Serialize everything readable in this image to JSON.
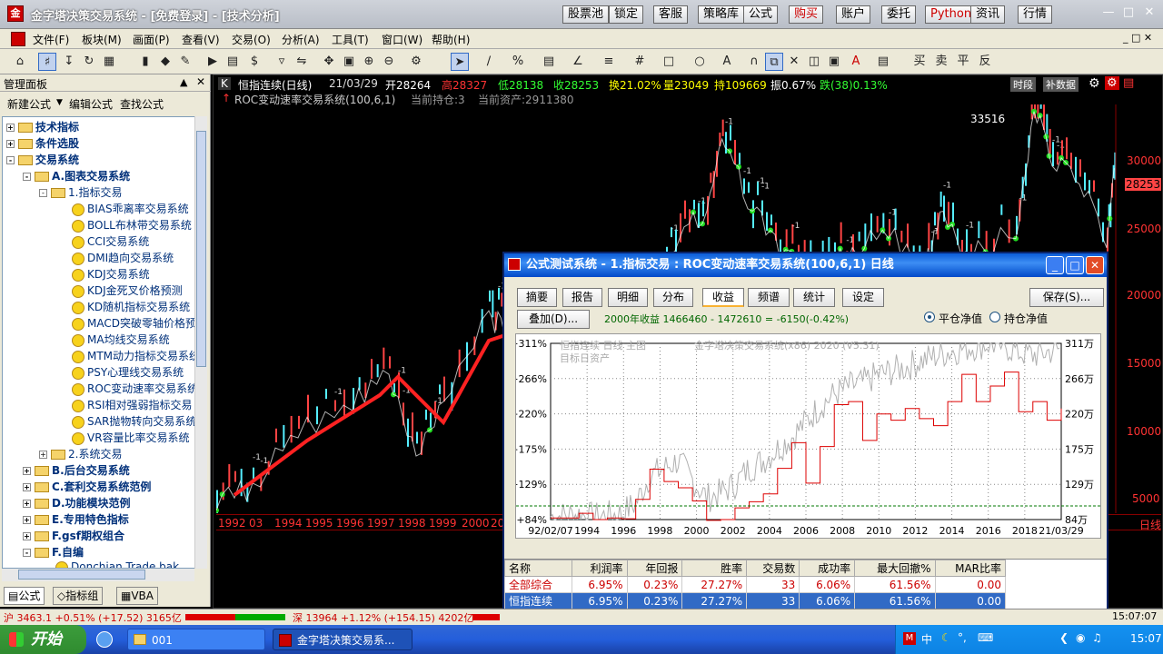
{
  "title_bar": {
    "title": "金字塔决策交易系统 - [免费登录] - [技术分析]",
    "buttons": [
      "股票池",
      "锁定",
      "客服",
      "策略库",
      "公式",
      "购买",
      "账户",
      "委托",
      "Python",
      "资讯",
      "行情"
    ]
  },
  "menu": [
    "文件(F)",
    "板块(M)",
    "画面(P)",
    "查看(V)",
    "交易(O)",
    "分析(A)",
    "工具(T)",
    "窗口(W)",
    "帮助(H)"
  ],
  "left_panel": {
    "title": "管理面板",
    "actions": [
      "新建公式",
      "编辑公式",
      "查找公式"
    ],
    "tree": [
      {
        "label": "技术指标",
        "level": 0,
        "type": "folder",
        "exp": "+"
      },
      {
        "label": "条件选股",
        "level": 0,
        "type": "folder",
        "exp": "+"
      },
      {
        "label": "交易系统",
        "level": 0,
        "type": "folder",
        "exp": "-"
      },
      {
        "label": "A.图表交易系统",
        "level": 1,
        "type": "folder",
        "exp": "-"
      },
      {
        "label": "1.指标交易",
        "level": 2,
        "type": "folder",
        "exp": "-"
      },
      {
        "label": "BIAS乖离率交易系统",
        "level": 3,
        "type": "item"
      },
      {
        "label": "BOLL布林带交易系统",
        "level": 3,
        "type": "item"
      },
      {
        "label": "CCI交易系统",
        "level": 3,
        "type": "item"
      },
      {
        "label": "DMI趋向交易系统",
        "level": 3,
        "type": "item"
      },
      {
        "label": "KDJ交易系统",
        "level": 3,
        "type": "item"
      },
      {
        "label": "KDJ金死叉价格预测",
        "level": 3,
        "type": "item"
      },
      {
        "label": "KD随机指标交易系统",
        "level": 3,
        "type": "item"
      },
      {
        "label": "MACD突破零轴价格预",
        "level": 3,
        "type": "item"
      },
      {
        "label": "MA均线交易系统",
        "level": 3,
        "type": "item"
      },
      {
        "label": "MTM动力指标交易系统",
        "level": 3,
        "type": "item"
      },
      {
        "label": "PSY心理线交易系统",
        "level": 3,
        "type": "item"
      },
      {
        "label": "ROC变动速率交易系统",
        "level": 3,
        "type": "item"
      },
      {
        "label": "RSI相对强弱指标交易",
        "level": 3,
        "type": "item"
      },
      {
        "label": "SAR抛物转向交易系统",
        "level": 3,
        "type": "item"
      },
      {
        "label": "VR容量比率交易系统",
        "level": 3,
        "type": "item"
      },
      {
        "label": "2.系统交易",
        "level": 2,
        "type": "folder",
        "exp": "+"
      },
      {
        "label": "B.后台交易系统",
        "level": 1,
        "type": "folder",
        "exp": "+"
      },
      {
        "label": "C.套利交易系统范例",
        "level": 1,
        "type": "folder",
        "exp": "+"
      },
      {
        "label": "D.功能模块范例",
        "level": 1,
        "type": "folder",
        "exp": "+"
      },
      {
        "label": "E.专用特色指标",
        "level": 1,
        "type": "folder",
        "exp": "+"
      },
      {
        "label": "F.gsf期权组合",
        "level": 1,
        "type": "folder",
        "exp": "+"
      },
      {
        "label": "F.自编",
        "level": 1,
        "type": "folder",
        "exp": "-"
      },
      {
        "label": "Donchian Trade.bak",
        "level": 2,
        "type": "item"
      }
    ],
    "bottom_tabs": [
      "公式",
      "指标组",
      "VBA"
    ]
  },
  "chart": {
    "header_line1": {
      "name": "恒指连续(日线)",
      "date": "21/03/29",
      "open": "开28264",
      "high": "高28327",
      "low": "低28138",
      "close": "收28253",
      "turnover": "换21.02%",
      "volume": "量23049",
      "hold": "持109669",
      "amplitude": "振0.67%",
      "change": "跌(38)0.13%"
    },
    "header_line2": {
      "system": "ROC变动速率交易系统(100,6,1)",
      "position": "当前持仓:3",
      "assets": "当前资产:2911380"
    },
    "right_buttons": [
      "时段",
      "补数据"
    ],
    "price_axis": [
      "30000",
      "25000",
      "20000",
      "15000",
      "10000",
      "5000"
    ],
    "last_price": "28253",
    "peak_label": "33516",
    "year_axis": [
      "1992",
      "03",
      "1994",
      "1995",
      "1996",
      "1997",
      "1998",
      "1999",
      "2000",
      "20"
    ],
    "period_label": "日线"
  },
  "dialog": {
    "title": "公式测试系统 - 1.指标交易 : ROC变动速率交易系统(100,6,1) 日线",
    "tabs": [
      "摘要",
      "报告",
      "明细",
      "分布",
      "收益",
      "频谱",
      "统计",
      "设定"
    ],
    "active_tab": "收益",
    "save_button": "保存(S)...",
    "overlay_button": "叠加(D)...",
    "year_return": "2000年收益 1466460 - 1472610 = -6150(-0.42%)",
    "radio_close": "平仓净值",
    "radio_hold": "持仓净值",
    "plot": {
      "legend1": "恒指连续 日线 主图",
      "legend2": "目标日资产",
      "watermark": "金字塔决策交易系统(x86) 2020 (V5.31)"
    },
    "table": {
      "headers": [
        "名称",
        "利润率",
        "年回报",
        "胜率",
        "交易数",
        "成功率",
        "最大回撤%",
        "MAR比率"
      ],
      "rows": [
        [
          "全部综合",
          "6.95%",
          "0.23%",
          "27.27%",
          "33",
          "6.06%",
          "61.56%",
          "0.00"
        ],
        [
          "恒指连续",
          "6.95%",
          "0.23%",
          "27.27%",
          "33",
          "6.06%",
          "61.56%",
          "0.00"
        ]
      ]
    }
  },
  "chart_data": {
    "type": "line",
    "title": "",
    "x": [
      "92/02/07",
      "1994",
      "1996",
      "1998",
      "2000",
      "2002",
      "2004",
      "2006",
      "2008",
      "2010",
      "2012",
      "2014",
      "2016",
      "2018",
      "21/03/29"
    ],
    "left_axis_labels": [
      "+311%",
      "+266%",
      "+220%",
      "+175%",
      "+129%",
      "+84%"
    ],
    "right_axis_labels": [
      "311万",
      "266万",
      "220万",
      "175万",
      "129万",
      "84万"
    ],
    "ylim": [
      84,
      311
    ],
    "series": [
      {
        "values": [
          86,
          86,
          92,
          84,
          86,
          85,
          110,
          149,
          133,
          125,
          108,
          83,
          84,
          99,
          107,
          117,
          150,
          183,
          131,
          178,
          232,
          236,
          186,
          220,
          212,
          227,
          214,
          205,
          236,
          271,
          236,
          256,
          274,
          223,
          236,
          212,
          227
        ]
      },
      {
        "values": [
          88,
          89,
          91,
          87,
          89,
          92,
          105,
          140,
          150,
          160,
          135,
          112,
          118,
          130,
          150,
          160,
          175,
          190,
          210,
          230,
          245,
          255,
          260,
          270,
          275,
          280,
          288,
          294,
          300,
          304,
          308,
          311,
          308,
          300,
          296,
          300,
          304
        ]
      }
    ]
  },
  "status_bar": {
    "sh": "沪 3463.1 +0.51% (+17.52) 3165亿",
    "sz": "深 13964 +1.12% (+154.15) 4202亿",
    "time": "15:07:07"
  },
  "taskbar": {
    "start": "开始",
    "items": [
      "001",
      "金字塔决策交易系..."
    ],
    "clock": "15:07",
    "ime": "中"
  }
}
